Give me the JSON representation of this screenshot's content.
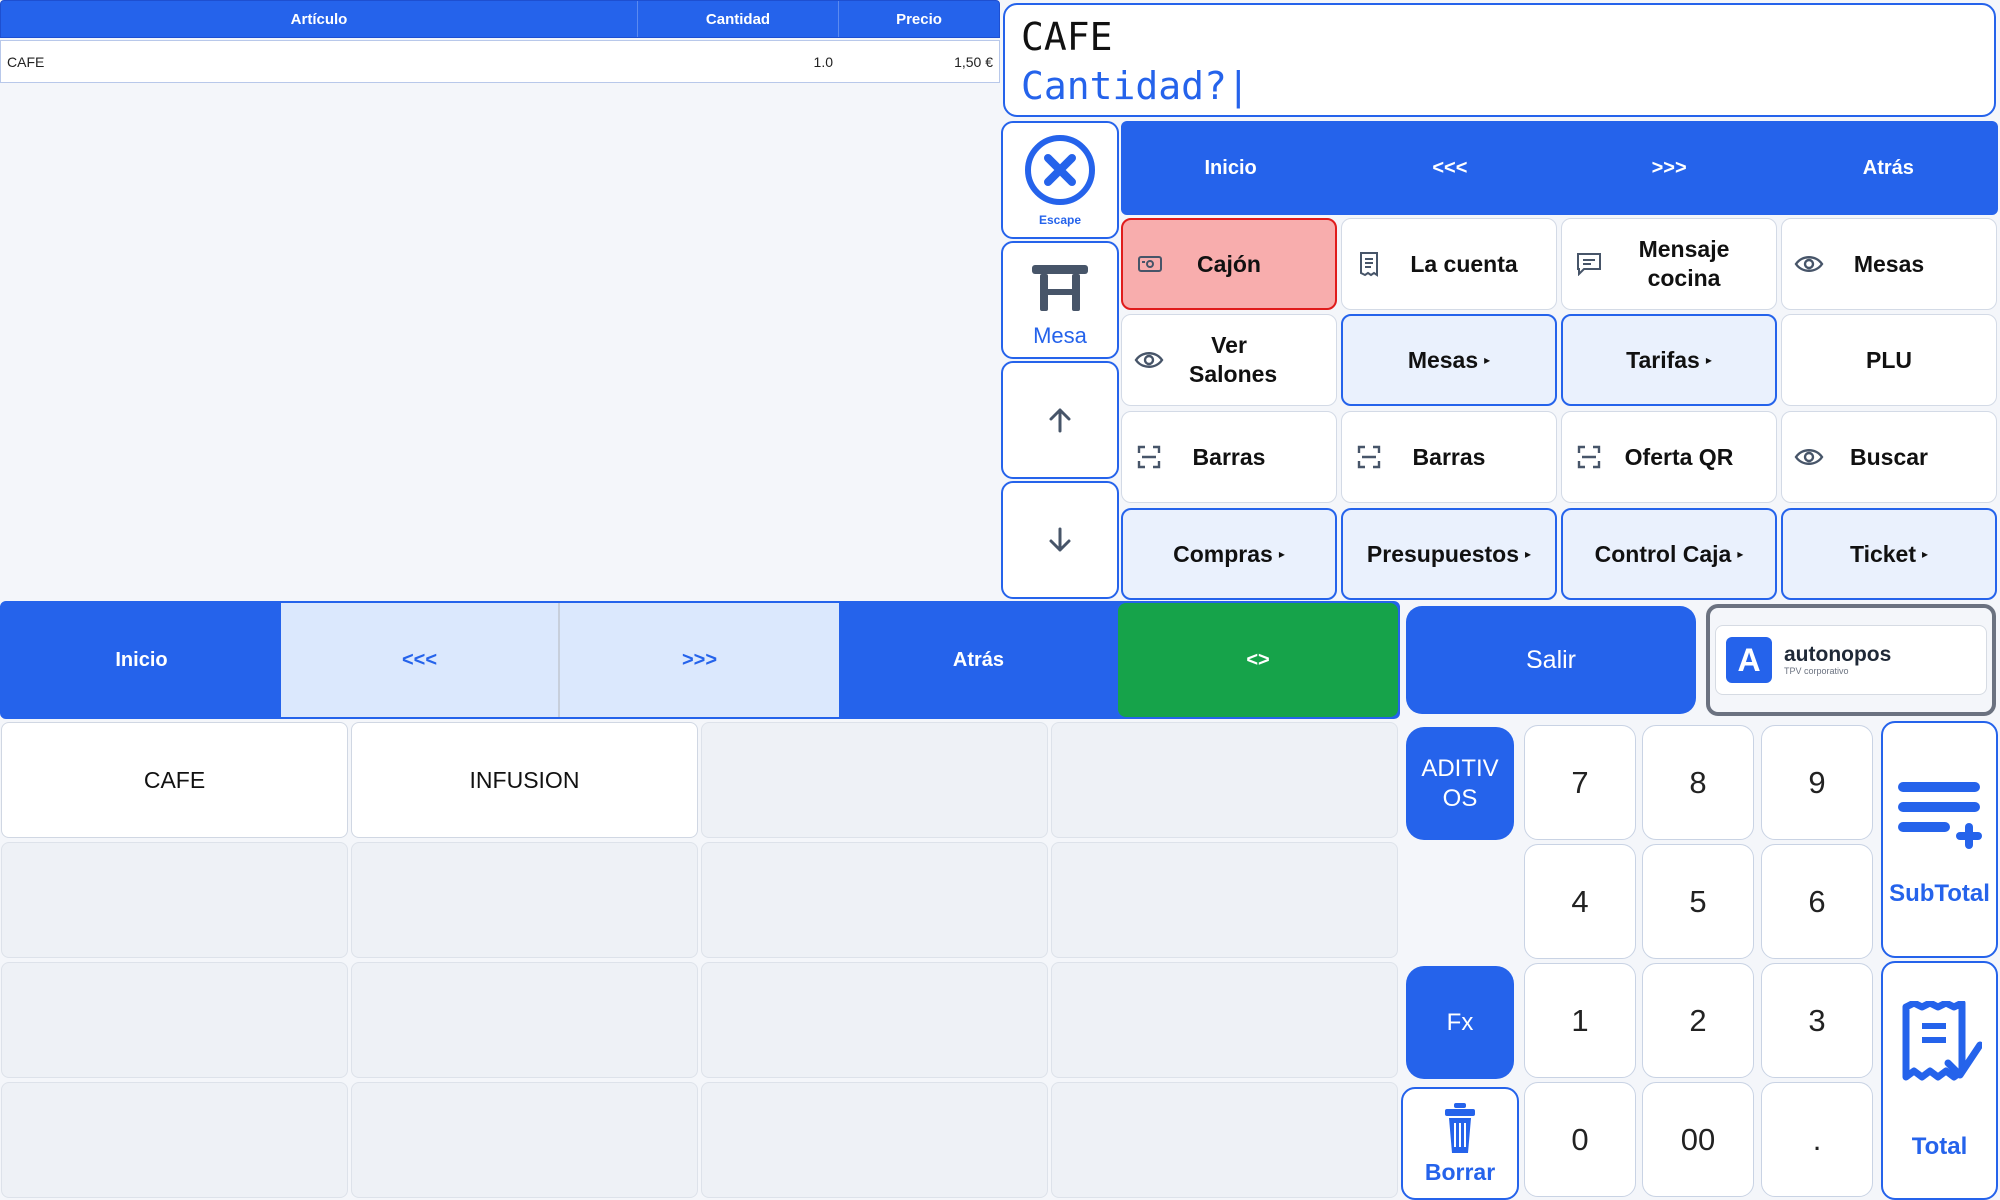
{
  "ticket": {
    "headers": [
      "Artículo",
      "Cantidad",
      "Precio"
    ],
    "rows": [
      {
        "item": "CAFE",
        "qty": "1.0",
        "price": "1,50 €"
      }
    ]
  },
  "display": {
    "line1": "CAFE",
    "line2": "Cantidad?|"
  },
  "side": {
    "escape": "Escape",
    "mesa": "Mesa"
  },
  "menu_nav": {
    "inicio": "Inicio",
    "prev": "<<<",
    "next": ">>>",
    "atras": "Atrás"
  },
  "functions": {
    "cajon": "Cajón",
    "la_cuenta": "La cuenta",
    "mensaje_cocina": "Mensaje cocina",
    "mesas": "Mesas",
    "ver_salones": "Ver Salones",
    "mesas_sub": "Mesas",
    "tarifas": "Tarifas",
    "plu": "PLU",
    "barras1": "Barras",
    "barras2": "Barras",
    "oferta_qr": "Oferta QR",
    "buscar": "Buscar",
    "compras": "Compras",
    "presupuestos": "Presupuestos",
    "control_caja": "Control Caja",
    "ticket": "Ticket",
    "submenu_marker": "▸"
  },
  "product_nav": {
    "inicio": "Inicio",
    "prev": "<<<",
    "next": ">>>",
    "atras": "Atrás",
    "toggle": "<>"
  },
  "salir": "Salir",
  "brand": {
    "name": "autonopos",
    "tagline": "TPV corporativo",
    "logo_letter": "A"
  },
  "products": [
    "CAFE",
    "INFUSION"
  ],
  "keypad": {
    "aditivos": "ADITIV OS",
    "fx": "Fx",
    "borrar": "Borrar",
    "k7": "7",
    "k8": "8",
    "k9": "9",
    "k4": "4",
    "k5": "5",
    "k6": "6",
    "k1": "1",
    "k2": "2",
    "k3": "3",
    "k0": "0",
    "k00": "00",
    "kdot": ".",
    "subtotal": "SubTotal",
    "total": "Total"
  },
  "colors": {
    "primary": "#2563eb",
    "green": "#16a34a",
    "cajon_bg": "#f8adad",
    "cajon_border": "#e01c1c"
  }
}
